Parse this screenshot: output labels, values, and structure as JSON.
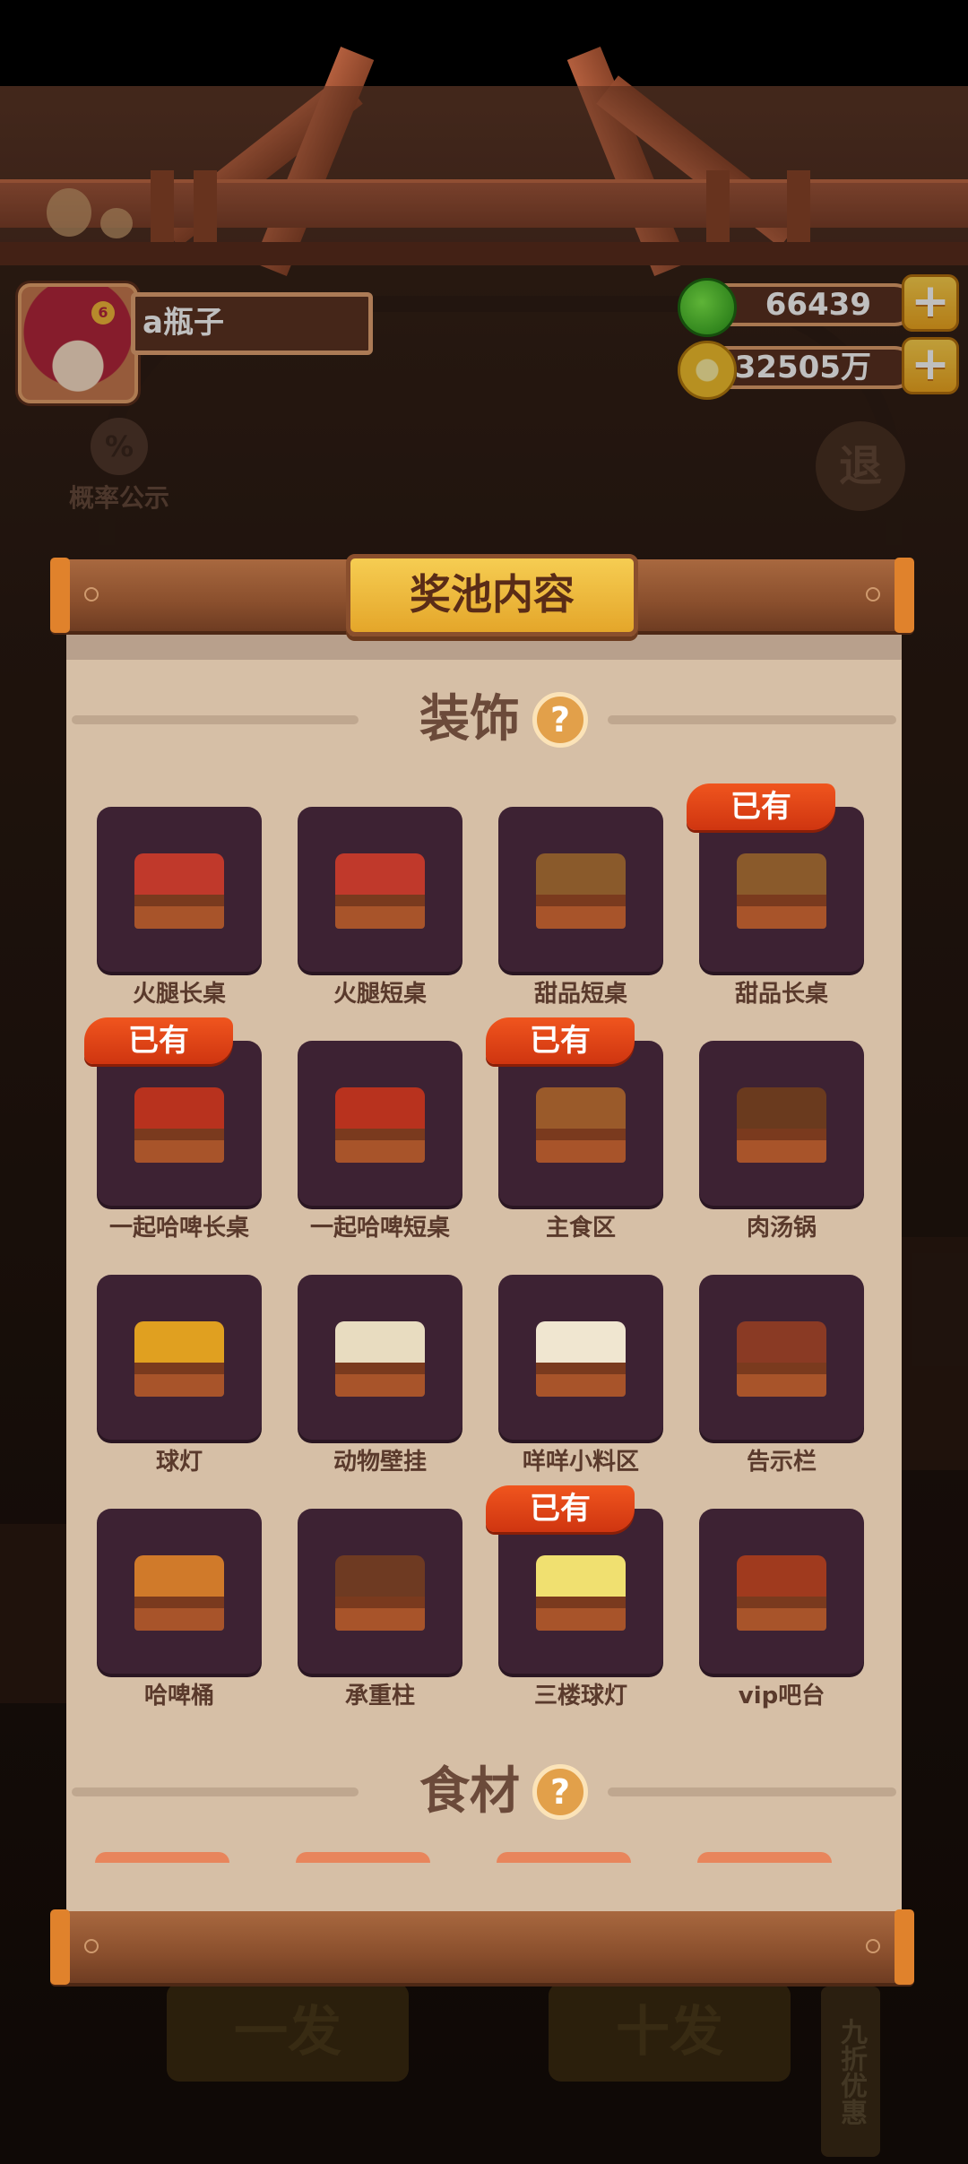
{
  "user": {
    "name": "a瓶子"
  },
  "resources": {
    "gems": {
      "icon": "green-gem-icon",
      "value": "66439"
    },
    "coins": {
      "icon": "gold-coin-icon",
      "value": "32505万"
    }
  },
  "background": {
    "probability_label": "概率公示",
    "exit_label": "退",
    "draw_one_label": "一发",
    "draw_ten_label": "十发",
    "discount_label": "九折优惠"
  },
  "modal": {
    "title": "奖池内容",
    "decoration_section": {
      "title": "装饰",
      "help_icon": "?",
      "items": [
        {
          "label": "火腿长桌",
          "owned": ""
        },
        {
          "label": "火腿短桌",
          "owned": ""
        },
        {
          "label": "甜品短桌",
          "owned": ""
        },
        {
          "label": "甜品长桌",
          "owned": "已有"
        },
        {
          "label": "一起哈啤长桌",
          "owned": "已有"
        },
        {
          "label": "一起哈啤短桌",
          "owned": ""
        },
        {
          "label": "主食区",
          "owned": "已有"
        },
        {
          "label": "肉汤锅",
          "owned": ""
        },
        {
          "label": "球灯",
          "owned": ""
        },
        {
          "label": "动物壁挂",
          "owned": ""
        },
        {
          "label": "咩咩小料区",
          "owned": ""
        },
        {
          "label": "告示栏",
          "owned": ""
        },
        {
          "label": "哈啤桶",
          "owned": ""
        },
        {
          "label": "承重柱",
          "owned": ""
        },
        {
          "label": "三楼球灯",
          "owned": "已有"
        },
        {
          "label": "vip吧台",
          "owned": ""
        }
      ]
    },
    "ingredient_section": {
      "title": "食材",
      "help_icon": "?"
    }
  },
  "colors": {
    "accent": "#f0a71f",
    "owned_badge": "#e0451a",
    "item_bg": "#3d2233",
    "paper": "#d6bfa6"
  }
}
